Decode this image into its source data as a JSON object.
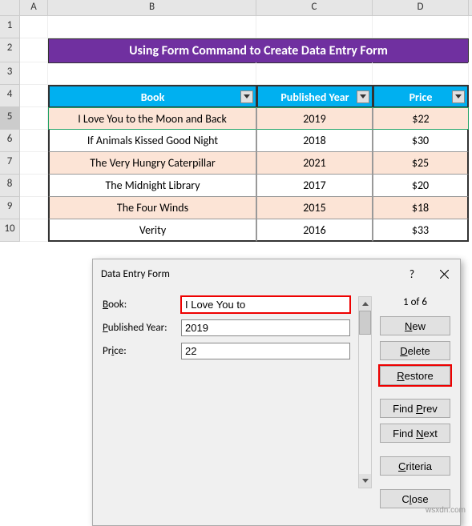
{
  "columns": {
    "A": "A",
    "B": "B",
    "C": "C",
    "D": "D"
  },
  "rows": [
    "1",
    "2",
    "3",
    "4",
    "5",
    "6",
    "7",
    "8",
    "9",
    "10"
  ],
  "title": "Using Form Command to Create Data Entry Form",
  "table": {
    "headers": {
      "book": "Book",
      "year": "Published Year",
      "price": "Price"
    },
    "rows": [
      {
        "book": "I Love You to the Moon and Back",
        "year": "2019",
        "price": "$22"
      },
      {
        "book": "If Animals Kissed Good Night",
        "year": "2018",
        "price": "$30"
      },
      {
        "book": "The Very Hungry Caterpillar",
        "year": "2021",
        "price": "$25"
      },
      {
        "book": "The Midnight Library",
        "year": "2017",
        "price": "$20"
      },
      {
        "book": "The Four Winds",
        "year": "2015",
        "price": "$18"
      },
      {
        "book": "Verity",
        "year": "2016",
        "price": "$33"
      }
    ]
  },
  "chart_data": {
    "type": "table",
    "headers": [
      "Book",
      "Published Year",
      "Price"
    ],
    "rows": [
      [
        "I Love You to the Moon and Back",
        2019,
        22
      ],
      [
        "If Animals Kissed Good Night",
        2018,
        30
      ],
      [
        "The Very Hungry Caterpillar",
        2021,
        25
      ],
      [
        "The Midnight Library",
        2017,
        20
      ],
      [
        "The Four Winds",
        2015,
        18
      ],
      [
        "Verity",
        2016,
        33
      ]
    ]
  },
  "dialog": {
    "title": "Data Entry Form",
    "help": "?",
    "fields": {
      "book_label": "Book:",
      "book_value": "I Love You to",
      "year_label": "Published Year:",
      "year_value": "2019",
      "price_label": "Price:",
      "price_value": "22"
    },
    "counter": "1 of 6",
    "buttons": {
      "new": "New",
      "delete": "Delete",
      "restore": "Restore",
      "findprev": "Find Prev",
      "findnext": "Find Next",
      "criteria": "Criteria",
      "close": "Close"
    }
  },
  "watermark": "wsxdn.com"
}
